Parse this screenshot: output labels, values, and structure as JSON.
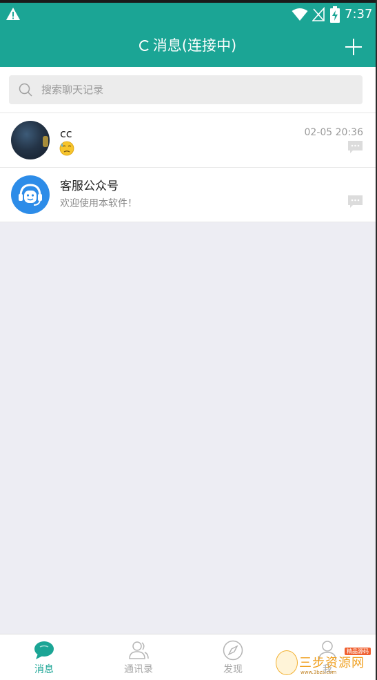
{
  "status_bar": {
    "time": "7:37",
    "icons": [
      "warning-icon",
      "wifi-icon",
      "no-signal-icon",
      "battery-charging-icon"
    ]
  },
  "header": {
    "title": "消息(连接中)",
    "connecting_indicator": "spinner-icon",
    "add_icon": "plus-icon"
  },
  "search": {
    "placeholder": "搜索聊天记录",
    "icon": "search-icon"
  },
  "conversations": [
    {
      "name": "cc",
      "preview_icon": "sweat-emoji-icon",
      "time": "02-05 20:36",
      "avatar": "night-sky-photo"
    },
    {
      "name": "客服公众号",
      "preview": "欢迎使用本软件！",
      "time": "",
      "avatar": "customer-service-icon"
    }
  ],
  "bottom_nav": [
    {
      "label": "消息",
      "icon": "chat-bubble-icon",
      "active": true
    },
    {
      "label": "通讯录",
      "icon": "contacts-icon",
      "active": false
    },
    {
      "label": "发现",
      "icon": "compass-icon",
      "active": false
    },
    {
      "label": "我",
      "icon": "person-icon",
      "active": false
    }
  ],
  "watermark": {
    "text": "三步资源网",
    "tag": "精品源码",
    "subtext": "www.3bzs.com"
  },
  "colors": {
    "accent": "#1ba595",
    "background": "#ededf3",
    "inactive": "#a8a8a8",
    "service_avatar": "#2d8ce8"
  }
}
